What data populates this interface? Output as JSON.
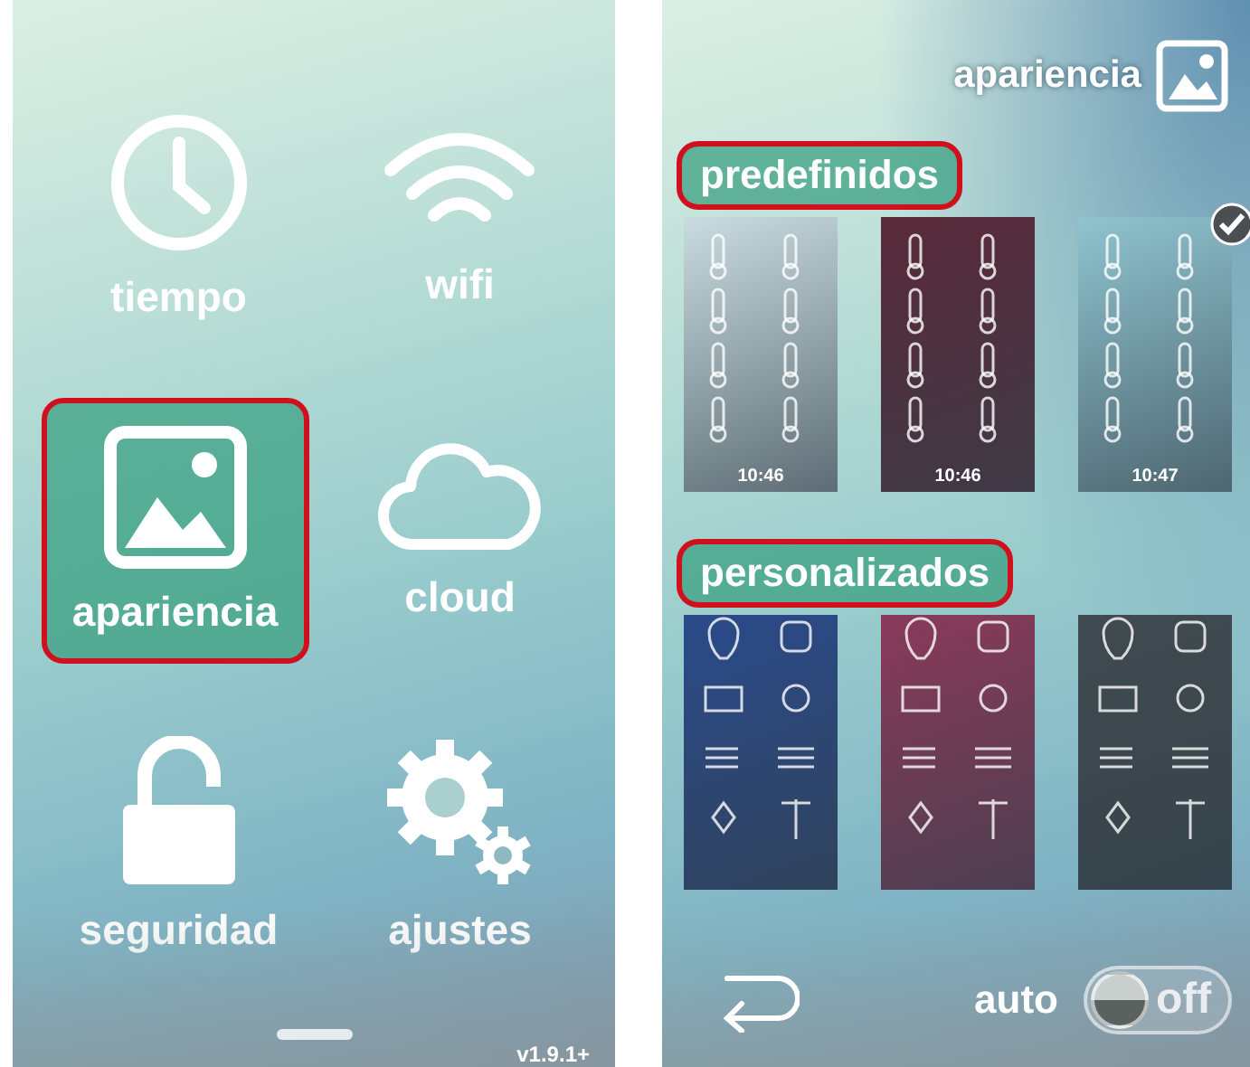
{
  "left_screen": {
    "tiles": [
      {
        "label": "tiempo",
        "kind": "clock",
        "selected": false
      },
      {
        "label": "wifi",
        "kind": "wifi",
        "selected": false
      },
      {
        "label": "apariencia",
        "kind": "image",
        "selected": true
      },
      {
        "label": "cloud",
        "kind": "cloud",
        "selected": false
      },
      {
        "label": "seguridad",
        "kind": "lock",
        "selected": false
      },
      {
        "label": "ajustes",
        "kind": "gears",
        "selected": false
      }
    ],
    "version": "v1.9.1+"
  },
  "right_screen": {
    "title": "apariencia",
    "sections": [
      {
        "title": "predefinidos",
        "themes": [
          {
            "kind": "zones",
            "time": "10:46",
            "color": "#c9dce0",
            "selected": false
          },
          {
            "kind": "zones",
            "time": "10:46",
            "color": "#5a2a3a",
            "selected": false
          },
          {
            "kind": "zones",
            "time": "10:47",
            "color": "#8fc4cf",
            "selected": true
          }
        ]
      },
      {
        "title": "personalizados",
        "themes": [
          {
            "kind": "devices",
            "color": "#2a4a8a",
            "selected": false
          },
          {
            "kind": "devices",
            "color": "#8a3a5a",
            "selected": false
          },
          {
            "kind": "devices",
            "color": "#404a50",
            "selected": false
          }
        ]
      }
    ],
    "auto_label": "auto",
    "toggle": {
      "label": "off",
      "on": false
    }
  }
}
